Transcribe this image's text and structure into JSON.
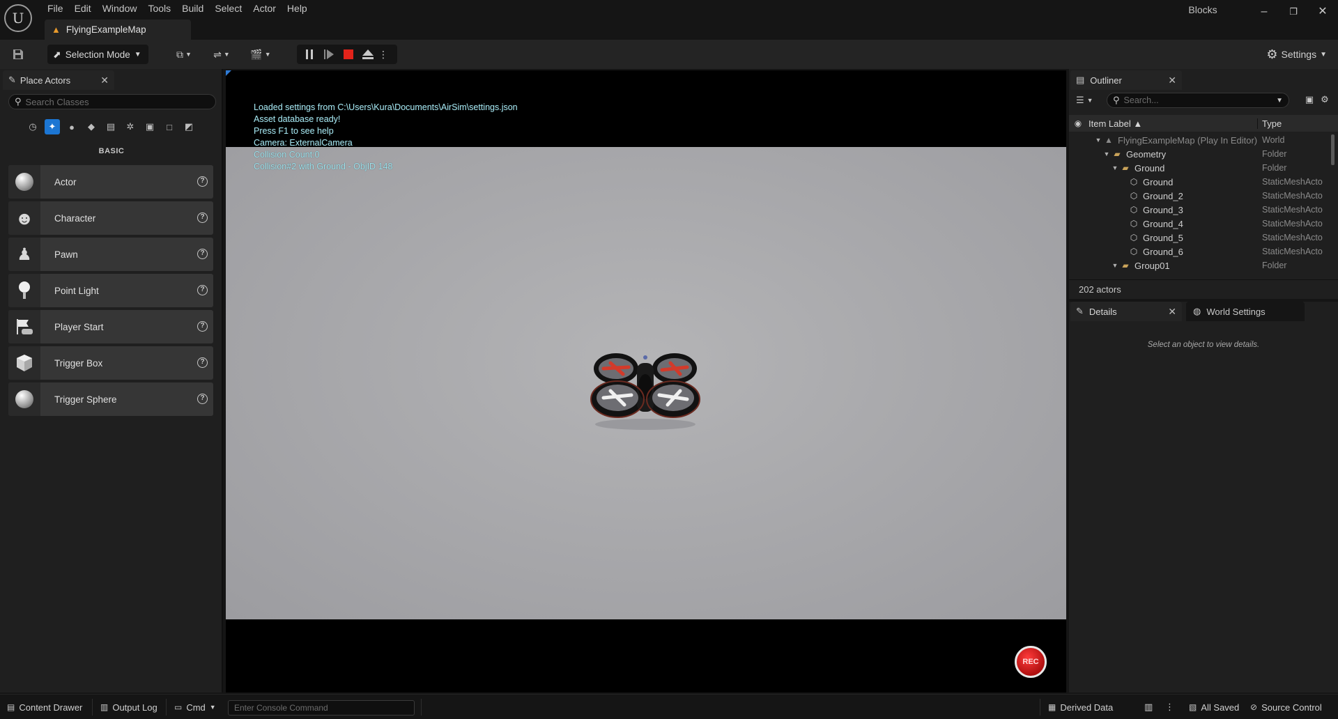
{
  "menu": [
    "File",
    "Edit",
    "Window",
    "Tools",
    "Build",
    "Select",
    "Actor",
    "Help"
  ],
  "map_tab": {
    "label": "FlyingExampleMap"
  },
  "project_name": "Blocks",
  "window_controls": {
    "minimize": "–",
    "restore": "❐",
    "close": "✕"
  },
  "toolbar": {
    "selection_mode": "Selection Mode",
    "settings": "Settings"
  },
  "place_actors": {
    "tab_label": "Place Actors",
    "search_placeholder": "Search Classes",
    "section_label": "BASIC",
    "items": [
      {
        "label": "Actor",
        "icon": "sphere-icon"
      },
      {
        "label": "Character",
        "icon": "character-icon"
      },
      {
        "label": "Pawn",
        "icon": "pawn-icon"
      },
      {
        "label": "Point Light",
        "icon": "point-light-icon"
      },
      {
        "label": "Player Start",
        "icon": "player-start-icon"
      },
      {
        "label": "Trigger Box",
        "icon": "trigger-box-icon"
      },
      {
        "label": "Trigger Sphere",
        "icon": "trigger-sphere-icon"
      }
    ]
  },
  "viewport": {
    "log": [
      "Loaded settings from C:\\Users\\Kura\\Documents\\AirSim\\settings.json",
      "Asset database ready!",
      "Press F1 to see help",
      "Camera: ExternalCamera",
      "Collision Count:0",
      "Collision#2 with Ground - ObjID 148"
    ],
    "rec_label": "REC"
  },
  "outliner": {
    "tab_label": "Outliner",
    "search_placeholder": "Search...",
    "col_label": "Item Label ▲",
    "col_type": "Type",
    "rows": [
      {
        "name": "FlyingExampleMap (Play In Editor)",
        "type": "World"
      },
      {
        "name": "Geometry",
        "type": "Folder"
      },
      {
        "name": "Ground",
        "type": "Folder"
      },
      {
        "name": "Ground",
        "type": "StaticMeshActo"
      },
      {
        "name": "Ground_2",
        "type": "StaticMeshActo"
      },
      {
        "name": "Ground_3",
        "type": "StaticMeshActo"
      },
      {
        "name": "Ground_4",
        "type": "StaticMeshActo"
      },
      {
        "name": "Ground_5",
        "type": "StaticMeshActo"
      },
      {
        "name": "Ground_6",
        "type": "StaticMeshActo"
      },
      {
        "name": "Group01",
        "type": "Folder"
      }
    ],
    "actor_count": "202 actors"
  },
  "details": {
    "tab_label": "Details",
    "world_settings_tab": "World Settings",
    "empty_text": "Select an object to view details."
  },
  "statusbar": {
    "content_drawer": "Content Drawer",
    "output_log": "Output Log",
    "cmd": "Cmd",
    "console_placeholder": "Enter Console Command",
    "derived_data": "Derived Data",
    "all_saved": "All Saved",
    "source_control": "Source Control"
  },
  "colors": {
    "accent": "#1c76d3",
    "stop": "#e2231a",
    "log_text": "#9fe3ee",
    "folder": "#c9a35a"
  }
}
